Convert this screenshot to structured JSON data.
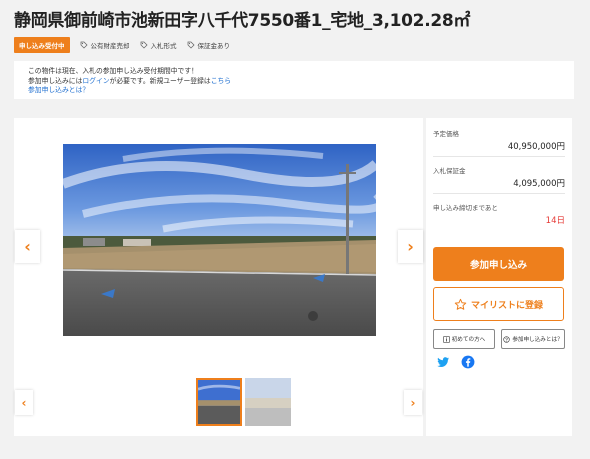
{
  "title": "静岡県御前崎市池新田字八千代7550番1_宅地_3,102.28㎡",
  "status_badge": "申し込み受付中",
  "tags": [
    "公有財産売却",
    "入札形式",
    "保証金あり"
  ],
  "notice": {
    "line1": "この物件は現在、入札の参加申し込み受付期間中です！",
    "line2_prefix": "参加申し込みには",
    "login_link": "ログイン",
    "line2_middle": "が必要です。新規ユーザー登録は",
    "register_link": "こちら",
    "help_link": "参加申し込みとは？"
  },
  "gallery": {
    "prev_arrow": "‹",
    "next_arrow": "›",
    "thumb_prev": "‹",
    "thumb_next": "›"
  },
  "sidebar": {
    "price_label": "予定価格",
    "price_value": "40,950,000円",
    "deposit_label": "入札保証金",
    "deposit_value": "4,095,000円",
    "deadline_label": "申し込み締切まであと",
    "deadline_value": "14日",
    "apply_button": "参加申し込み",
    "favorite_button": "マイリストに登録",
    "beginner_button": "初めての方へ",
    "what_is_apply_button": "参加申し込みとは？"
  },
  "colors": {
    "accent": "#ee7f1c",
    "link": "#1f6fd0",
    "deadline": "#e53935",
    "twitter": "#1da1f2",
    "facebook": "#1877f2"
  },
  "icons": [
    "tag-icon",
    "star-icon",
    "info-icon",
    "question-icon",
    "twitter-icon",
    "facebook-icon"
  ]
}
